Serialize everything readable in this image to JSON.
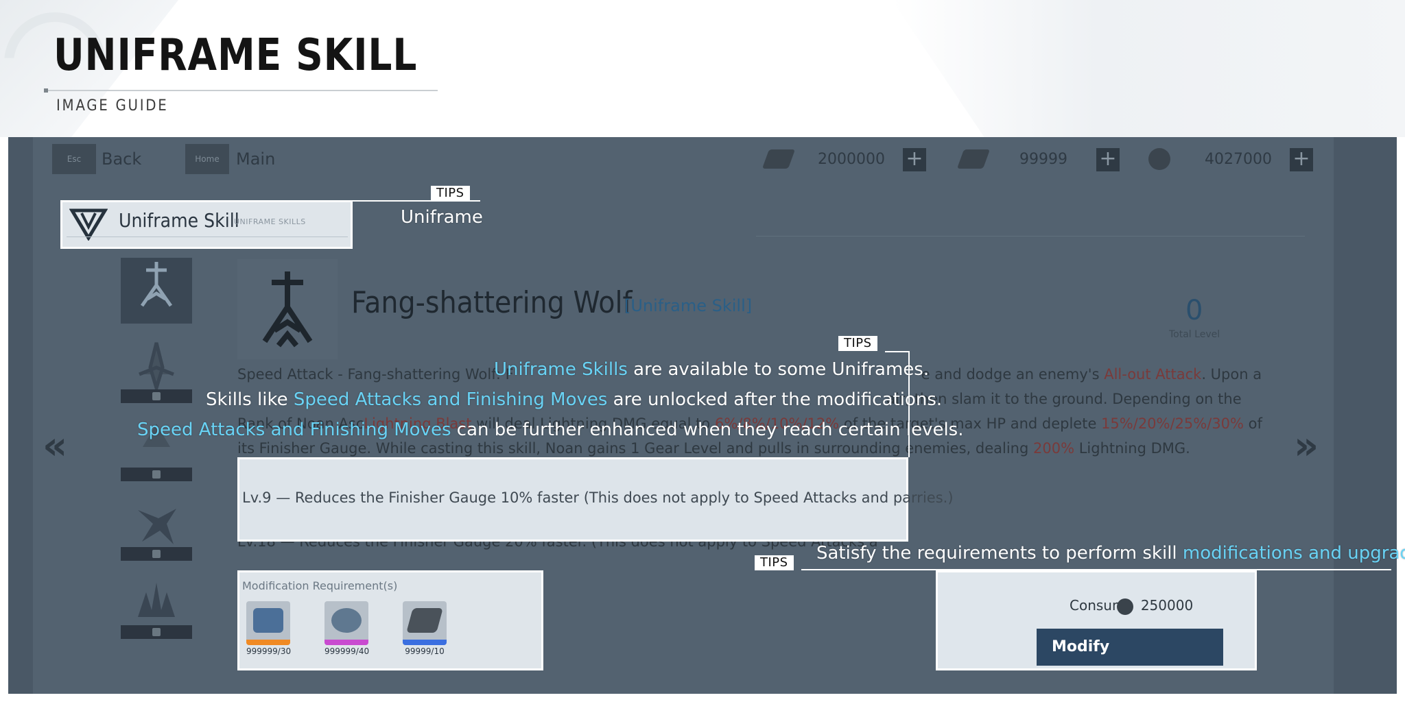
{
  "header": {
    "title": "UNIFRAME SKILL",
    "subtitle": "IMAGE GUIDE"
  },
  "topbar": {
    "back_key": "Esc",
    "back_label": "Back",
    "main_key": "Home",
    "main_label": "Main",
    "resource_1": "2000000",
    "resource_2": "99999",
    "resource_3": "4027000"
  },
  "uniframe_tab": {
    "title": "Uniframe Skill",
    "subtitle": "UNIFRAME SKILLS"
  },
  "skill": {
    "name": "Fang-shattering Wolf",
    "tag": "[Uniframe Skill]",
    "level_value": "0",
    "level_label": "Total Level",
    "desc": {
      "l1a": "Speed Attack - Fang-shattering Wolf: F",
      "l1b": "e and dodge an enemy's ",
      "l1c": "All-out Attack",
      "l1d": ". Upon a",
      "l2": "air, then slam it to the ground. Depending on the",
      "l3a": "Rank of Noan Asc",
      "l3b": "Lightning Blast",
      "l3c": " will deal Lightning DMG equal to ",
      "l3d": "6%/8%/10%/12%",
      "l3e": " of the target's max HP and deplete ",
      "l3f": "15%/20%/25%/30%",
      "l3g": " of",
      "l4a": "its Finisher Gauge. While casting this skill, Noan gains 1 Gear Level and pulls in surrounding enemies, dealing ",
      "l4b": "200%",
      "l4c": " Lightning DMG."
    },
    "lv9": "Lv.9 — Reduces the Finisher Gauge 10% faster (This does not apply to Speed Attacks and parries.)",
    "lv18": "Lv.18 — Reduces the Finisher Gauge 20% faster. (This does not apply to Speed Attacks a"
  },
  "modification": {
    "title": "Modification Requirement(s)",
    "materials": [
      {
        "count": "999999/30",
        "icon": "material-core-icon",
        "color": "#f08a24"
      },
      {
        "count": "999999/40",
        "icon": "material-gear-icon",
        "color": "#c94bd0"
      },
      {
        "count": "99999/10",
        "icon": "material-plate-icon",
        "color": "#3b6fe0"
      }
    ]
  },
  "modify_panel": {
    "consume_label": "Consum",
    "consume_value": "250000",
    "button_label": "Modify"
  },
  "tips": {
    "tag": "TIPS",
    "tip1": "Uniframe",
    "tip2_l1_accent": "Uniframe Skills",
    "tip2_l1_rest": " are available to some Uniframes.",
    "tip2_l2_start": "Skills like ",
    "tip2_l2_accent": "Speed Attacks and Finishing Moves",
    "tip2_l2_rest": " are unlocked after the modifications.",
    "tip2_l3_accent": "Speed Attacks and Finishing Moves",
    "tip2_l3_rest": " can be further enhanced when they reach certain levels.",
    "tip3_start": "Satisfy the requirements to perform skill ",
    "tip3_accent": "modifications and upgrades."
  },
  "colors": {
    "accent": "#69d3f5",
    "panel_bg": "#4a5866",
    "modify_button": "#2c4763"
  }
}
